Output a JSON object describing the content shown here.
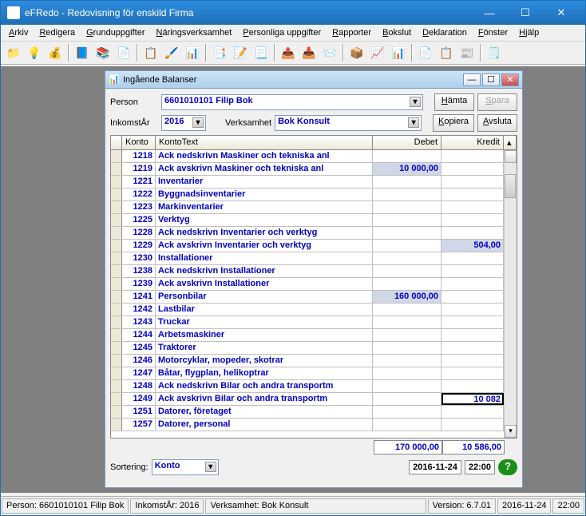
{
  "window": {
    "title": "eFRedo - Redovisning för enskild Firma"
  },
  "menu": [
    "Arkiv",
    "Redigera",
    "Grunduppgifter",
    "Näringsverksamhet",
    "Personliga uppgifter",
    "Rapporter",
    "Bokslut",
    "Deklaration",
    "Fönster",
    "Hjälp"
  ],
  "child": {
    "title": "Ingående Balanser",
    "person_label": "Person",
    "person_value": "6601010101    Filip Bok",
    "year_label": "InkomstÅr",
    "year_value": "2016",
    "verk_label": "Verksamhet",
    "verk_value": "Bok Konsult",
    "btn_hamta": "Hämta",
    "btn_spara": "Spara",
    "btn_kopiera": "Kopiera",
    "btn_avsluta": "Avsluta",
    "headers": {
      "konto": "Konto",
      "text": "KontoText",
      "debet": "Debet",
      "kredit": "Kredit"
    },
    "rows": [
      {
        "k": "1218",
        "t": "Ack nedskrivn Maskiner och tekniska anl",
        "d": "",
        "c": ""
      },
      {
        "k": "1219",
        "t": "Ack avskrivn Maskiner och tekniska anl",
        "d": "10 000,00",
        "c": "",
        "hl_d": true
      },
      {
        "k": "1221",
        "t": "Inventarier",
        "d": "",
        "c": ""
      },
      {
        "k": "1222",
        "t": "Byggnadsinventarier",
        "d": "",
        "c": ""
      },
      {
        "k": "1223",
        "t": "Markinventarier",
        "d": "",
        "c": ""
      },
      {
        "k": "1225",
        "t": "Verktyg",
        "d": "",
        "c": ""
      },
      {
        "k": "1228",
        "t": "Ack nedskrivn Inventarier och verktyg",
        "d": "",
        "c": ""
      },
      {
        "k": "1229",
        "t": "Ack avskrivn Inventarier och verktyg",
        "d": "",
        "c": "504,00",
        "hl_c": true
      },
      {
        "k": "1230",
        "t": "Installationer",
        "d": "",
        "c": ""
      },
      {
        "k": "1238",
        "t": "Ack nedskrivn Installationer",
        "d": "",
        "c": ""
      },
      {
        "k": "1239",
        "t": "Ack avskrivn Installationer",
        "d": "",
        "c": ""
      },
      {
        "k": "1241",
        "t": "Personbilar",
        "d": "160 000,00",
        "c": "",
        "hl_d": true
      },
      {
        "k": "1242",
        "t": "Lastbilar",
        "d": "",
        "c": ""
      },
      {
        "k": "1243",
        "t": "Truckar",
        "d": "",
        "c": ""
      },
      {
        "k": "1244",
        "t": "Arbetsmaskiner",
        "d": "",
        "c": ""
      },
      {
        "k": "1245",
        "t": "Traktorer",
        "d": "",
        "c": ""
      },
      {
        "k": "1246",
        "t": "Motorcyklar, mopeder, skotrar",
        "d": "",
        "c": ""
      },
      {
        "k": "1247",
        "t": "Båtar, flygplan, helikoptrar",
        "d": "",
        "c": ""
      },
      {
        "k": "1248",
        "t": "Ack nedskrivn Bilar och andra transportm",
        "d": "",
        "c": ""
      },
      {
        "k": "1249",
        "t": "Ack avskrivn Bilar och andra transportm",
        "d": "",
        "c": "10 082",
        "sel": true
      },
      {
        "k": "1251",
        "t": "Datorer, företaget",
        "d": "",
        "c": ""
      },
      {
        "k": "1257",
        "t": "Datorer, personal",
        "d": "",
        "c": ""
      }
    ],
    "total_debet": "170 000,00",
    "total_kredit": "10 586,00",
    "sort_label": "Sortering:",
    "sort_value": "Konto",
    "date": "2016-11-24",
    "time": "22:00"
  },
  "status": {
    "person": "Person: 6601010101  Filip Bok",
    "year": "InkomstÅr: 2016",
    "verk": "Verksamhet: Bok Konsult",
    "ver": "Version: 6.7.01",
    "date": "2016-11-24",
    "time": "22:00"
  }
}
